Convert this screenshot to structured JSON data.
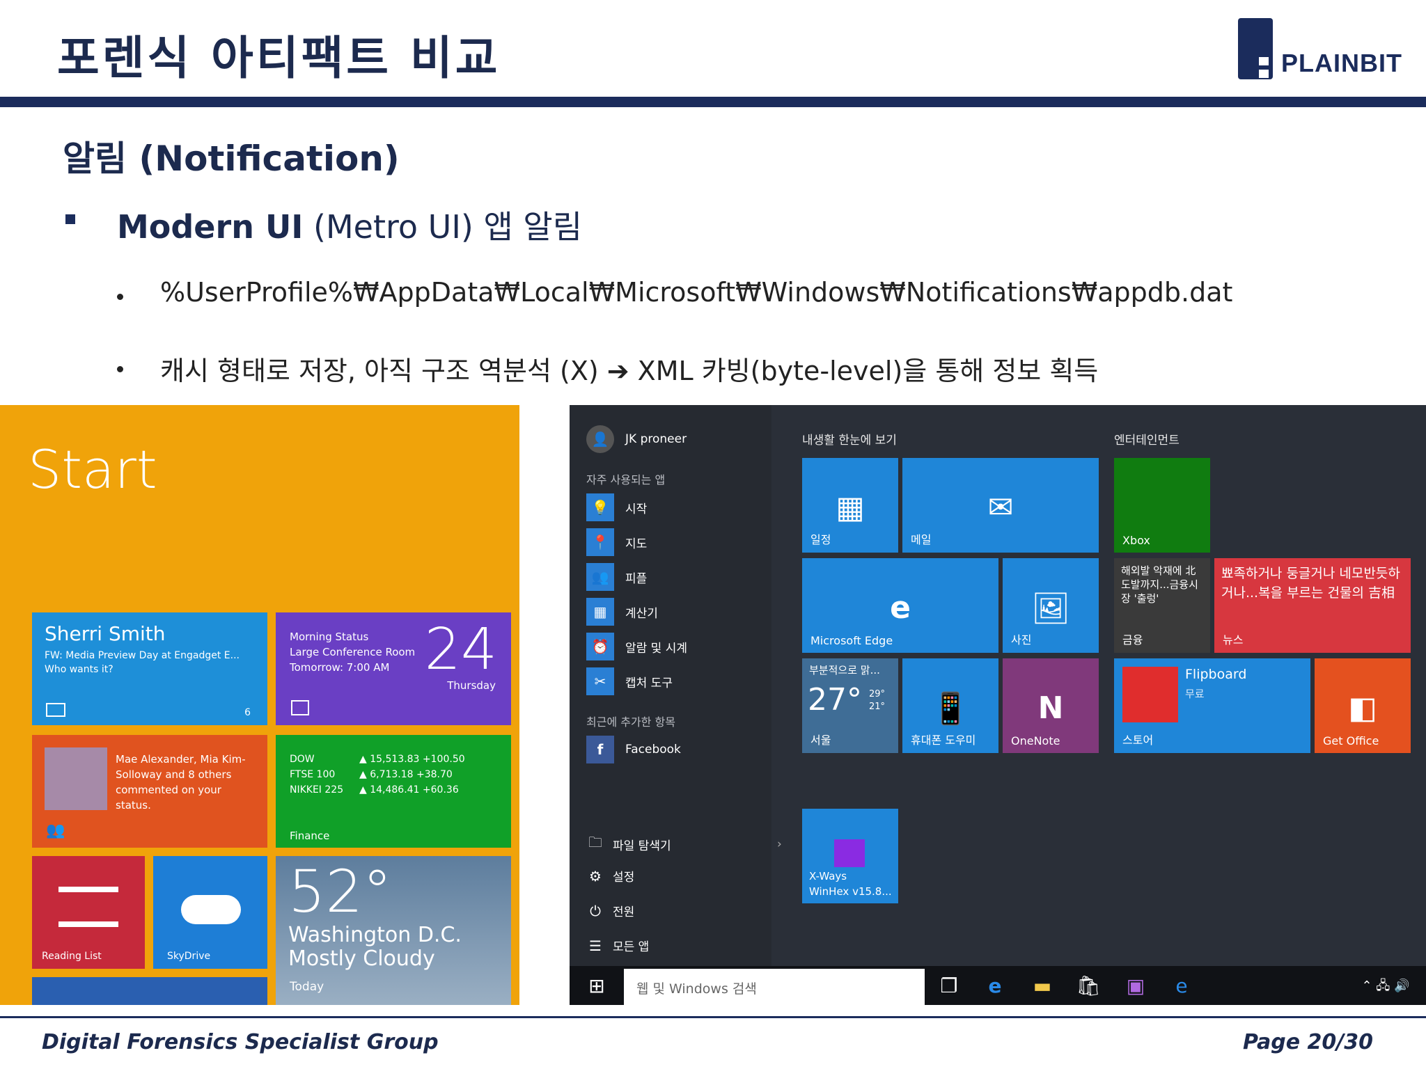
{
  "slide": {
    "title": "포렌식 아티팩트 비교",
    "subtitle": "알림 (Notification)",
    "bullet1_bold": "Modern UI",
    "bullet1_rest": " (Metro UI) 앱 알림",
    "sub1": "%UserProfile%₩AppData₩Local₩Microsoft₩Windows₩Notifications₩appdb.dat",
    "sub2": "캐시 형태로 저장, 아직 구조 역분석 (X) ➔ XML 카빙(byte-level)을 통해 정보 획득"
  },
  "logo": {
    "text": "PLAINBIT"
  },
  "footer": {
    "left": "Digital Forensics Specialist Group",
    "right": "Page 20/30"
  },
  "win8": {
    "start": "Start",
    "mail": {
      "name": "Sherri Smith",
      "line1": "FW: Media Preview Day at Engadget E...",
      "line2": "Who wants it?",
      "count": "6"
    },
    "cal": {
      "l1": "Morning Status",
      "l2": "Large Conference Room",
      "l3": "Tomorrow: 7:00 AM",
      "day": "24",
      "weekday": "Thursday"
    },
    "people": {
      "text": "Mae Alexander, Mia Kim-Solloway and 8 others commented on your status."
    },
    "finance": {
      "r1": "DOW",
      "v1": "▲ 15,513.83 +100.50",
      "r2": "FTSE 100",
      "v2": "▲ 6,713.18 +38.70",
      "r3": "NIKKEI 225",
      "v3": "▲ 14,486.41 +60.36",
      "label": "Finance"
    },
    "reading": "Reading List",
    "skydrive": "SkyDrive",
    "weather": {
      "temp": "52°",
      "city": "Washington D.C.",
      "cond": "Mostly Cloudy",
      "today": "Today"
    }
  },
  "win10": {
    "user": "JK proneer",
    "freq": "자주 사용되는 앱",
    "apps": [
      "시작",
      "지도",
      "피플",
      "계산기",
      "알람 및 시계",
      "캡처 도구"
    ],
    "recent": "최근에 추가한 항목",
    "facebook": "Facebook",
    "sys": [
      "파일 탐색기",
      "설정",
      "전원",
      "모든 앱"
    ],
    "group1": "내생활 한눈에 보기",
    "group2": "엔터테인먼트",
    "tiles": {
      "calendar": "일정",
      "mail": "메일",
      "edge": "Microsoft Edge",
      "photos": "사진",
      "weather_head": "부분적으로 맑...",
      "weather_temp": "27°",
      "weather_hi": "29°",
      "weather_lo": "21°",
      "weather_city": "서울",
      "phone": "휴대폰 도우미",
      "onenote": "OneNote",
      "xbox": "Xbox",
      "news1": "해외발 악재에 北도발까지...금융시장 '출렁'",
      "news1_label": "금융",
      "news2": "뾰족하거나 둥글거나 네모반듯하거나...복을 부르는 건물의 吉相",
      "news2_label": "뉴스",
      "flipboard": "Flipboard",
      "flip_sub": "무료",
      "store": "스토어",
      "office": "Get Office",
      "xways1": "X-Ways",
      "xways2": "WinHex v15.8..."
    },
    "search": "웹 및 Windows 검색"
  },
  "icons": {
    "b1": "square-bullet",
    "sub": "round-bullet"
  }
}
